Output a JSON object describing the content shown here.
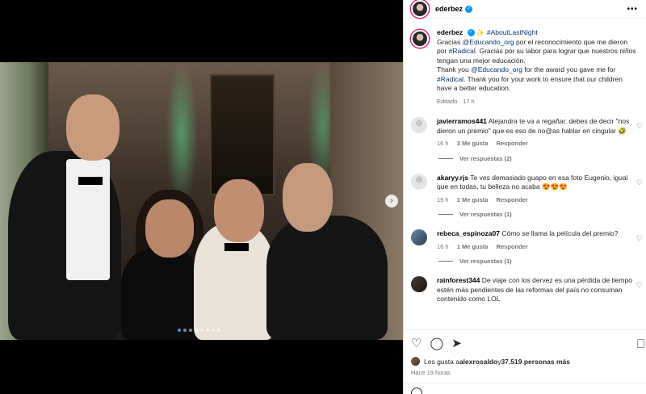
{
  "post": {
    "username": "ederbez",
    "verified_badge": "✓",
    "more_icon": "•••",
    "carousel": {
      "total": 8,
      "active_index": 0
    },
    "next_arrow": "›"
  },
  "caption": {
    "username": "ederbez",
    "sparkle": "✨",
    "hashtag_top": "#AboutLastNight",
    "line1_a": "Gracias ",
    "mention1": "@Educando_org",
    "line1_b": " por el reconocimiento que me dieron por ",
    "hashtag_es": "#Radical",
    "line1_c": ". Gracias por su labor para lograr que nuestros niños tengan una mejor educación.",
    "line2_a": "Thank you ",
    "mention2": "@Educando_org",
    "line2_b": " for the award you gave me for ",
    "hashtag_en": "#Radical",
    "line2_c": ". Thank you for your work to ensure that our children have a better education.",
    "meta": "Editado · 17 h"
  },
  "comments": [
    {
      "user": "javierramos441",
      "text": "Alejandra te va a regañar. debes de decir \"nos dieron un premio\" que es eso de no@as hablar en cingular 🤣",
      "time": "16 h",
      "likes": "3 Me gusta",
      "reply": "Responder",
      "view_replies": "Ver respuestas (2)"
    },
    {
      "user": "akaryy.rjs",
      "text": "Te ves demasiado guapo en esa foto Eugenio, igual que en todas, tu belleza no acaba 😍😍😍",
      "time": "19 h",
      "likes": "1 Me gusta",
      "reply": "Responder",
      "view_replies": "Ver respuestas (1)"
    },
    {
      "user": "rebeca_espinoza07",
      "text": "Cómo se llama la película del premio?",
      "time": "16 h",
      "likes": "1 Me gusta",
      "reply": "Responder",
      "view_replies": "Ver respuestas (1)"
    },
    {
      "user": "rainforest344",
      "text": "De viaje con los dervez es una pérdida de tiempo estén más pendientes de las reformas del país no consuman contenido como LOL",
      "time": "",
      "likes": "",
      "reply": "",
      "view_replies": ""
    }
  ],
  "icons": {
    "like": "♡",
    "comment": "◯",
    "share": "➤",
    "save": "⎕",
    "comment_heart": "♡"
  },
  "likes": {
    "prefix": "Les gusta a ",
    "user": "alexrosaldo",
    "middle": " y ",
    "count": "37.519 personas más"
  },
  "posted_ago": "Hace 19 horas"
}
